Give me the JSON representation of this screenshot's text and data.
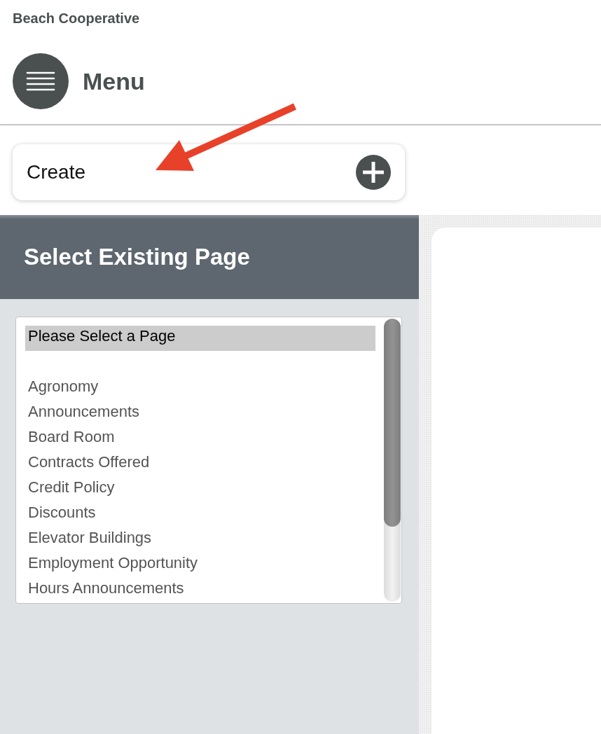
{
  "header": {
    "site_title": "Beach Cooperative",
    "menu_button": {
      "label": "Menu"
    }
  },
  "create_button": {
    "label": "Create"
  },
  "page_selector": {
    "title": "Select Existing Page",
    "options": [
      {
        "kind": "option",
        "label": "Please Select a Page",
        "selected": true
      },
      {
        "kind": "blank",
        "selected": false
      },
      {
        "kind": "option",
        "label": "Agronomy",
        "selected": false
      },
      {
        "kind": "option",
        "label": "Announcements",
        "selected": false
      },
      {
        "kind": "option",
        "label": "Board Room",
        "selected": false
      },
      {
        "kind": "option",
        "label": "Contracts Offered",
        "selected": false
      },
      {
        "kind": "option",
        "label": "Credit Policy",
        "selected": false
      },
      {
        "kind": "option",
        "label": "Discounts",
        "selected": false
      },
      {
        "kind": "option",
        "label": "Elevator Buildings",
        "selected": false
      },
      {
        "kind": "option",
        "label": "Employment Opportunity",
        "selected": false
      },
      {
        "kind": "option",
        "label": "Hours Announcements",
        "selected": false
      }
    ]
  }
}
